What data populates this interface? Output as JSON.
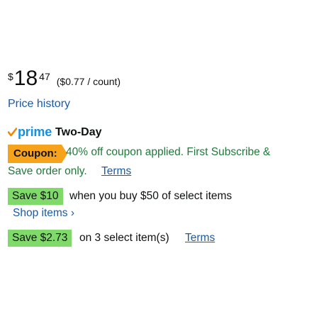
{
  "price": {
    "currency_symbol": "$",
    "whole": "18",
    "fraction": "47",
    "unit_price": "($0.77 / count)"
  },
  "price_history_link": "Price history",
  "prime": {
    "logo_text": "prime",
    "speed": "Two-Day",
    "check_color": "#f08804",
    "logo_color": "#1a8fdd"
  },
  "coupon": {
    "badge_label": "Coupon:",
    "badge_color": "#f7a21b",
    "text_line1": "40% off coupon applied. First Subscribe &",
    "text_line2": "Save order only.",
    "terms_label": "Terms",
    "text_color": "#1f7a3a"
  },
  "promos": [
    {
      "badge": "Save $10",
      "text": "when you buy $50 of select items",
      "link": "Shop items ›"
    },
    {
      "badge": "Save $2.73",
      "text": "on 3 select item(s)",
      "link": "Terms"
    }
  ],
  "colors": {
    "link": "#1a5aa8",
    "save_badge": "#7fda69"
  }
}
